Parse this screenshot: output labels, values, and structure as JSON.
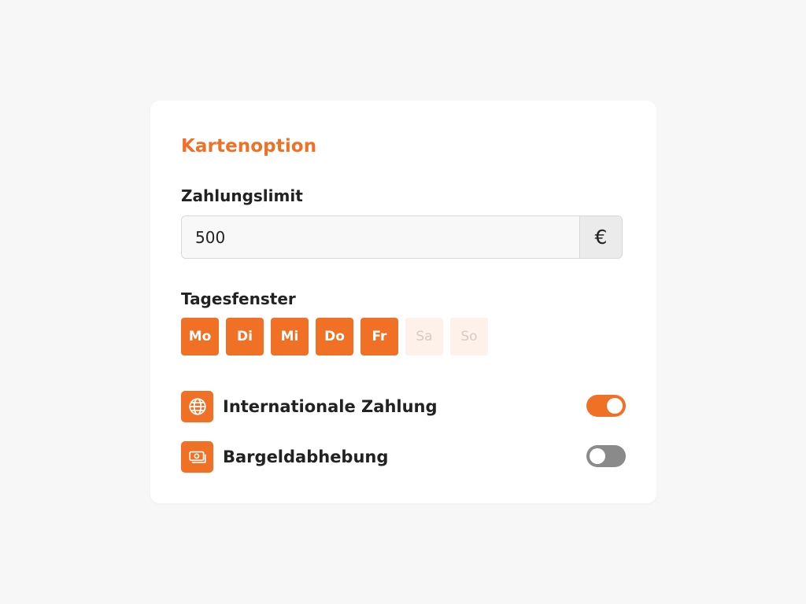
{
  "card": {
    "title": "Kartenoption"
  },
  "limit": {
    "label": "Zahlungslimit",
    "value": "500",
    "currency_symbol": "€"
  },
  "days": {
    "label": "Tagesfenster",
    "items": [
      {
        "label": "Mo",
        "selected": true
      },
      {
        "label": "Di",
        "selected": true
      },
      {
        "label": "Mi",
        "selected": true
      },
      {
        "label": "Do",
        "selected": true
      },
      {
        "label": "Fr",
        "selected": true
      },
      {
        "label": "Sa",
        "selected": false
      },
      {
        "label": "So",
        "selected": false
      }
    ]
  },
  "options": {
    "international": {
      "label": "Internationale Zahlung",
      "icon": "globe-icon",
      "enabled": true
    },
    "cash": {
      "label": "Bargeldabhebung",
      "icon": "cash-icon",
      "enabled": false
    }
  },
  "colors": {
    "accent": "#f07126",
    "day_off_bg": "#fdf1ea",
    "toggle_off": "#8a8a8a",
    "page_bg": "#f7f7f7"
  }
}
